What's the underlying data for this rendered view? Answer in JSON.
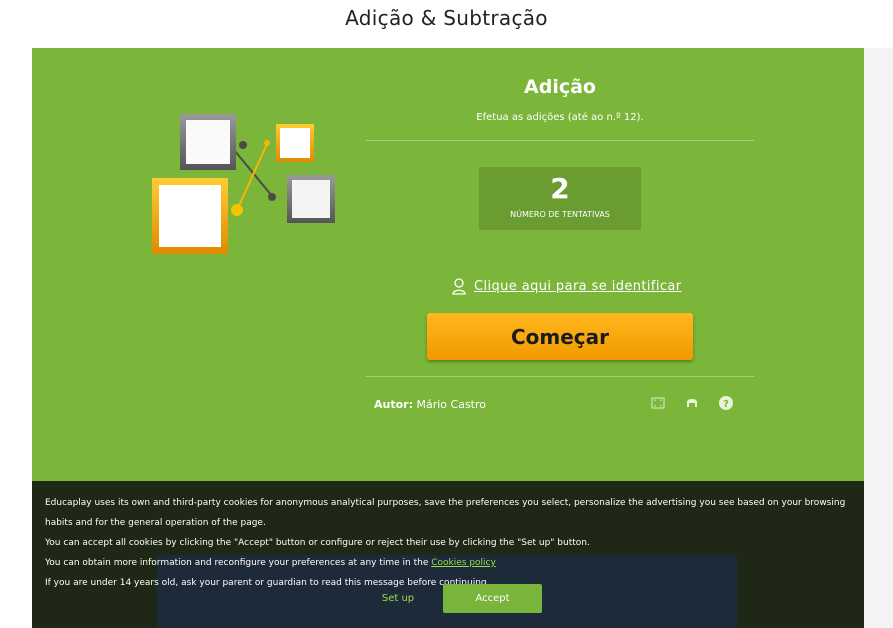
{
  "page": {
    "title": "Adição & Subtração"
  },
  "activity": {
    "title": "Adição",
    "subtitle": "Efetua as adições (até ao n.º 12).",
    "tries_count": "2",
    "tries_label": "NÚMERO DE TENTATIVAS",
    "identify_link": "Clique aqui para se identificar",
    "start_button": "Começar",
    "author_label": "Autor:",
    "author_name": "Mário Castro"
  },
  "icons": {
    "user": "user-icon",
    "fullscreen": "fullscreen-icon",
    "print": "print-icon",
    "help": "help-icon"
  },
  "cookies": {
    "line1": "Educaplay uses its own and third-party cookies for anonymous analytical purposes, save the preferences you select, personalize the advertising you see based on your browsing habits and for the general operation of the page.",
    "line2": "You can accept all cookies by clicking the \"Accept\" button or configure or reject their use by clicking the \"Set up\" button.",
    "line3_pre": "You can obtain more information and reconfigure your preferences at any time in the ",
    "line3_link": "Cookies policy",
    "line4": "If you are under 14 years old, ask your parent or guardian to read this message before continuing.",
    "setup_button": "Set up",
    "accept_button": "Accept"
  },
  "colors": {
    "panel": "#7bb53a",
    "button": "#f5a70d",
    "accent_link": "#9bdd45"
  }
}
